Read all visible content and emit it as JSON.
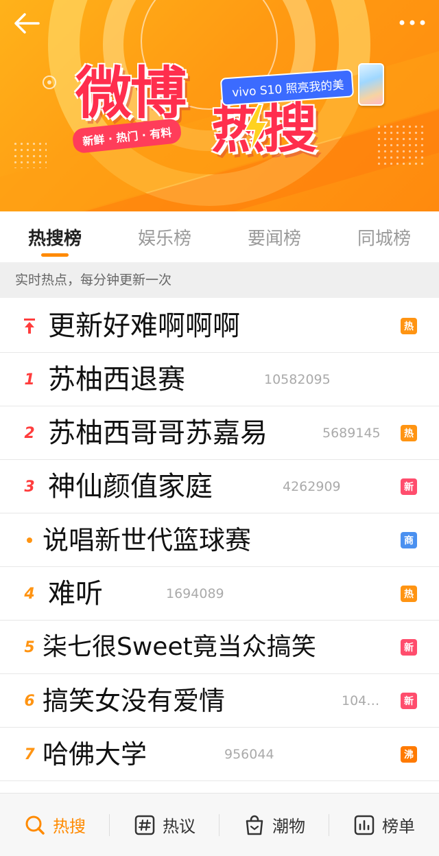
{
  "colors": {
    "accent": "#ff8a00",
    "rank_top": "#ff3d3d",
    "rank_other": "#ff9412",
    "badge_hot": "#ff9412",
    "badge_new": "#ff4d6d",
    "badge_ad": "#4a90f0",
    "badge_boil": "#ff7a00"
  },
  "banner": {
    "logo_weibo": "微博",
    "logo_resou": "热搜",
    "tagline": "新鲜 · 热门 · 有料",
    "sponsor_text": "vivo S10 照亮我的美"
  },
  "tabs": [
    {
      "label": "热搜榜",
      "active": true
    },
    {
      "label": "娱乐榜",
      "active": false
    },
    {
      "label": "要闻榜",
      "active": false
    },
    {
      "label": "同城榜",
      "active": false
    }
  ],
  "subtitle": "实时热点，每分钟更新一次",
  "list": [
    {
      "rank": "",
      "marker": "pin-icon",
      "title": "更新好难啊啊啊",
      "count": "",
      "badge": "热",
      "badge_type": "hot"
    },
    {
      "rank": "1",
      "marker": "",
      "title": "苏柚西退赛",
      "count": "10582095",
      "badge": "",
      "badge_type": ""
    },
    {
      "rank": "2",
      "marker": "",
      "title": "苏柚西哥哥苏嘉易",
      "count": "5689145",
      "badge": "热",
      "badge_type": "hot"
    },
    {
      "rank": "3",
      "marker": "",
      "title": "神仙颜值家庭",
      "count": "4262909",
      "badge": "新",
      "badge_type": "new"
    },
    {
      "rank": "",
      "marker": "dot-icon",
      "title": "说唱新世代篮球赛",
      "count": "",
      "badge": "商",
      "badge_type": "ad"
    },
    {
      "rank": "4",
      "marker": "",
      "title": "难听",
      "count": "1694089",
      "badge": "热",
      "badge_type": "hot"
    },
    {
      "rank": "5",
      "marker": "",
      "title": "柒七很Sweet竟当众搞笑",
      "count": "",
      "badge": "新",
      "badge_type": "new"
    },
    {
      "rank": "6",
      "marker": "",
      "title": "搞笑女没有爱情",
      "count": "104…",
      "badge": "新",
      "badge_type": "new"
    },
    {
      "rank": "7",
      "marker": "",
      "title": "哈佛大学",
      "count": "956044",
      "badge": "沸",
      "badge_type": "boil"
    }
  ],
  "bottom_nav": [
    {
      "label": "热搜",
      "icon": "search-icon",
      "active": true
    },
    {
      "label": "热议",
      "icon": "hashtag-icon",
      "active": false
    },
    {
      "label": "潮物",
      "icon": "shopping-bag-icon",
      "active": false
    },
    {
      "label": "榜单",
      "icon": "bar-chart-icon",
      "active": false
    }
  ]
}
